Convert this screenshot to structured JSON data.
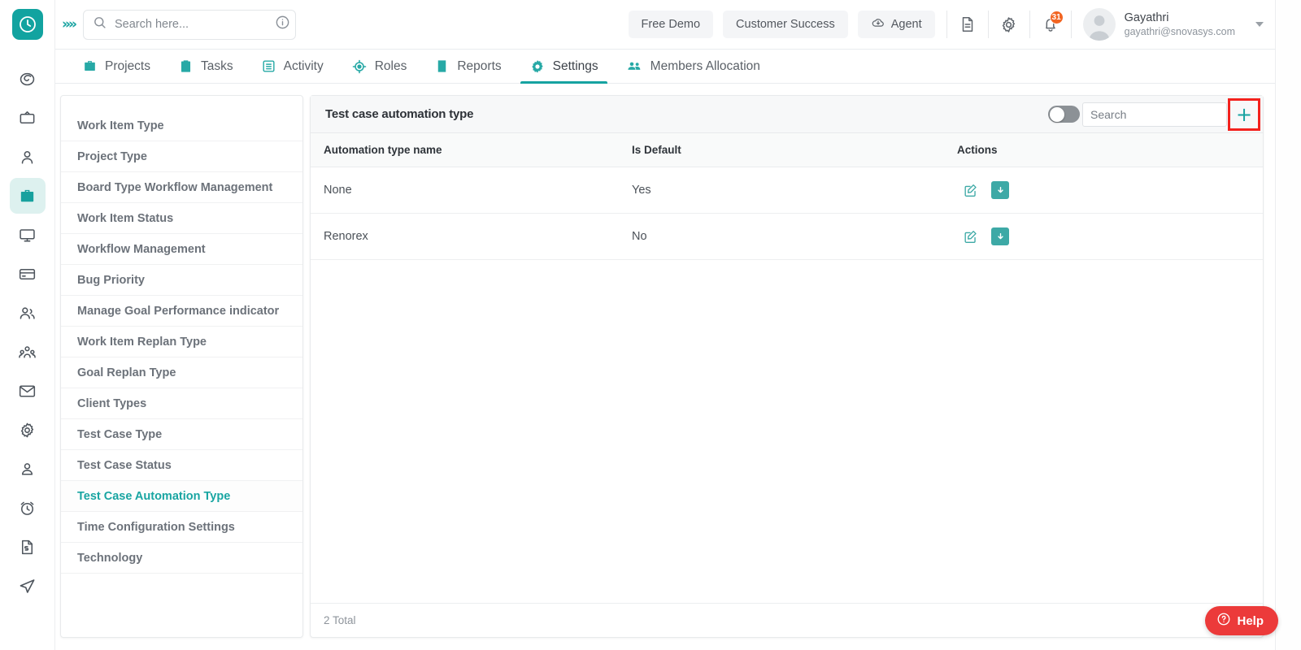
{
  "header": {
    "logo_icon": "clock-logo-icon",
    "expand_icon": "chevron-double-right-icon",
    "search": {
      "placeholder": "Search here...",
      "value": "",
      "icon": "search-icon",
      "info_icon": "info-circle-icon"
    },
    "buttons": [
      {
        "label": "Free Demo",
        "name": "free-demo-button"
      },
      {
        "label": "Customer Success",
        "name": "customer-success-button"
      },
      {
        "label": "Agent",
        "name": "agent-button",
        "icon": "cloud-download-icon"
      }
    ],
    "doc_icon": "document-icon",
    "settings_icon": "gear-icon",
    "notification": {
      "icon": "bell-icon",
      "count": "31"
    },
    "user": {
      "name": "Gayathri",
      "email": "gayathri@snovasys.com",
      "avatar": "user-avatar",
      "caret": "chevron-down-icon"
    }
  },
  "nav": {
    "tabs": [
      {
        "label": "Projects",
        "icon": "briefcase-icon",
        "active": false
      },
      {
        "label": "Tasks",
        "icon": "clipboard-icon",
        "active": false
      },
      {
        "label": "Activity",
        "icon": "list-box-icon",
        "active": false
      },
      {
        "label": "Roles",
        "icon": "target-icon",
        "active": false
      },
      {
        "label": "Reports",
        "icon": "report-icon",
        "active": false
      },
      {
        "label": "Settings",
        "icon": "gear-icon",
        "active": true
      },
      {
        "label": "Members Allocation",
        "icon": "people-icon",
        "active": false
      }
    ]
  },
  "rail": {
    "items": [
      {
        "icon": "target-spiral-icon",
        "active": false
      },
      {
        "icon": "tv-icon",
        "active": false
      },
      {
        "icon": "user-icon",
        "active": false
      },
      {
        "icon": "briefcase-icon",
        "active": true
      },
      {
        "icon": "monitor-icon",
        "active": false
      },
      {
        "icon": "card-icon",
        "active": false
      },
      {
        "icon": "users-icon",
        "active": false
      },
      {
        "icon": "team-icon",
        "active": false
      },
      {
        "icon": "mail-icon",
        "active": false
      },
      {
        "icon": "gear-icon",
        "active": false
      },
      {
        "icon": "person-badge-icon",
        "active": false
      },
      {
        "icon": "alarm-clock-icon",
        "active": false
      },
      {
        "icon": "invoice-icon",
        "active": false
      },
      {
        "icon": "send-icon",
        "active": false
      }
    ]
  },
  "settings_menu": {
    "items": [
      {
        "label": "Work Item Type",
        "active": false
      },
      {
        "label": "Project Type",
        "active": false
      },
      {
        "label": "Board Type Workflow Management",
        "active": false
      },
      {
        "label": "Work Item Status",
        "active": false
      },
      {
        "label": "Workflow Management",
        "active": false
      },
      {
        "label": "Bug Priority",
        "active": false
      },
      {
        "label": "Manage Goal Performance indicator",
        "active": false
      },
      {
        "label": "Work Item Replan Type",
        "active": false
      },
      {
        "label": "Goal Replan Type",
        "active": false
      },
      {
        "label": "Client Types",
        "active": false
      },
      {
        "label": "Test Case Type",
        "active": false
      },
      {
        "label": "Test Case Status",
        "active": false
      },
      {
        "label": "Test Case Automation Type",
        "active": true
      },
      {
        "label": "Time Configuration Settings",
        "active": false
      },
      {
        "label": "Technology",
        "active": false
      }
    ]
  },
  "main": {
    "title": "Test case automation type",
    "toggle": {
      "name": "filter-toggle",
      "state": "off"
    },
    "search": {
      "placeholder": "Search",
      "value": ""
    },
    "add_button": {
      "label": "+",
      "highlighted": true,
      "highlight_color": "#f3211d"
    },
    "table": {
      "columns": [
        "Automation type name",
        "Is Default",
        "Actions"
      ],
      "rows": [
        {
          "name": "None",
          "is_default": "Yes",
          "actions": [
            "edit-icon",
            "archive-down-icon"
          ]
        },
        {
          "name": "Renorex",
          "is_default": "No",
          "actions": [
            "edit-icon",
            "archive-down-icon"
          ]
        }
      ]
    },
    "footer_total": "2 Total"
  },
  "help": {
    "label": "Help",
    "icon": "question-circle-icon"
  },
  "colors": {
    "accent": "#16a3a1",
    "badge": "#f26522",
    "help": "#ec3a3a",
    "highlight": "#f3211d"
  }
}
